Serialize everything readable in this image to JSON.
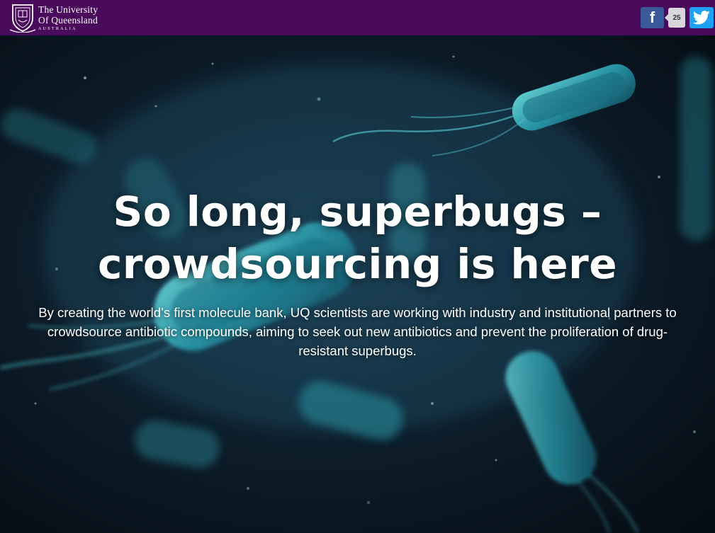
{
  "header": {
    "logo": {
      "line1": "The University",
      "line2": "Of Queensland",
      "line3": "AUSTRALIA"
    },
    "background_color": "#4a0a5c",
    "social": {
      "facebook_icon": "facebook-icon",
      "facebook_label": "f",
      "share_count": "25",
      "twitter_icon": "twitter-icon"
    }
  },
  "hero": {
    "title_line1": "So long, superbugs –",
    "title_line2": "crowdsourcing is here",
    "description": "By creating the world’s first molecule bank, UQ scientists are working with industry and institutional partners to crowdsource antibiotic compounds, aiming to seek out new antibiotics and prevent the proliferation of drug-resistant superbugs.",
    "accent_color": "#4fd6e0"
  }
}
